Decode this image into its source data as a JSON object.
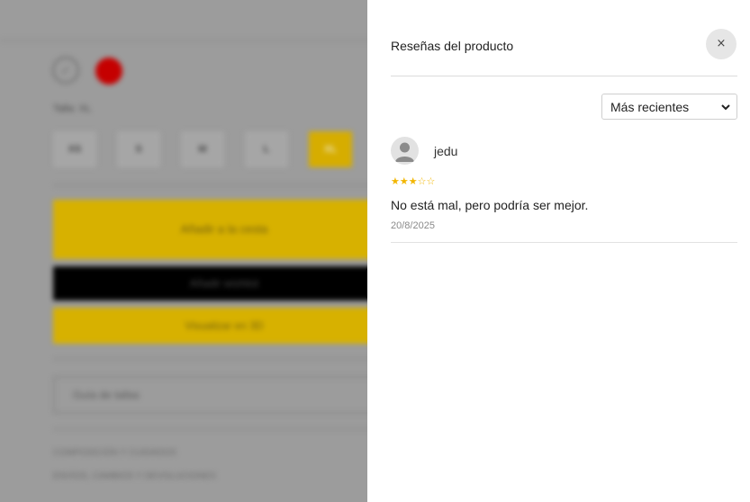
{
  "background_page": {
    "size_label": "Talla: XL",
    "sizes": [
      "XS",
      "S",
      "M",
      "L",
      "XL"
    ],
    "selected_size_index": 4,
    "add_to_cart_label": "Añadir a la cesta",
    "wishlist_label": "Añadir wishlist",
    "view_3d_label": "Visualizar en 3D",
    "size_guide_label": "Guía de tallas",
    "links": [
      "COMPOSICIÓN Y CUIDADOS",
      "ENVÍOS, CAMBIOS Y DEVOLUCIONES"
    ],
    "colors": {
      "swatch_red": "#c50000",
      "accent_yellow": "#d7b100"
    }
  },
  "reviews_panel": {
    "title": "Reseñas del producto",
    "close_glyph": "×",
    "sort": {
      "selected": "Más recientes"
    },
    "reviews": [
      {
        "author": "jedu",
        "rating": 3,
        "max_rating": 5,
        "stars_text": "★★★☆☆",
        "text": "No está mal, pero podría ser mejor.",
        "date": "20/8/2025",
        "avatar_icon": "user-avatar-icon"
      }
    ],
    "colors": {
      "star": "#f2b600",
      "close_bg": "#e6e6e6"
    }
  }
}
